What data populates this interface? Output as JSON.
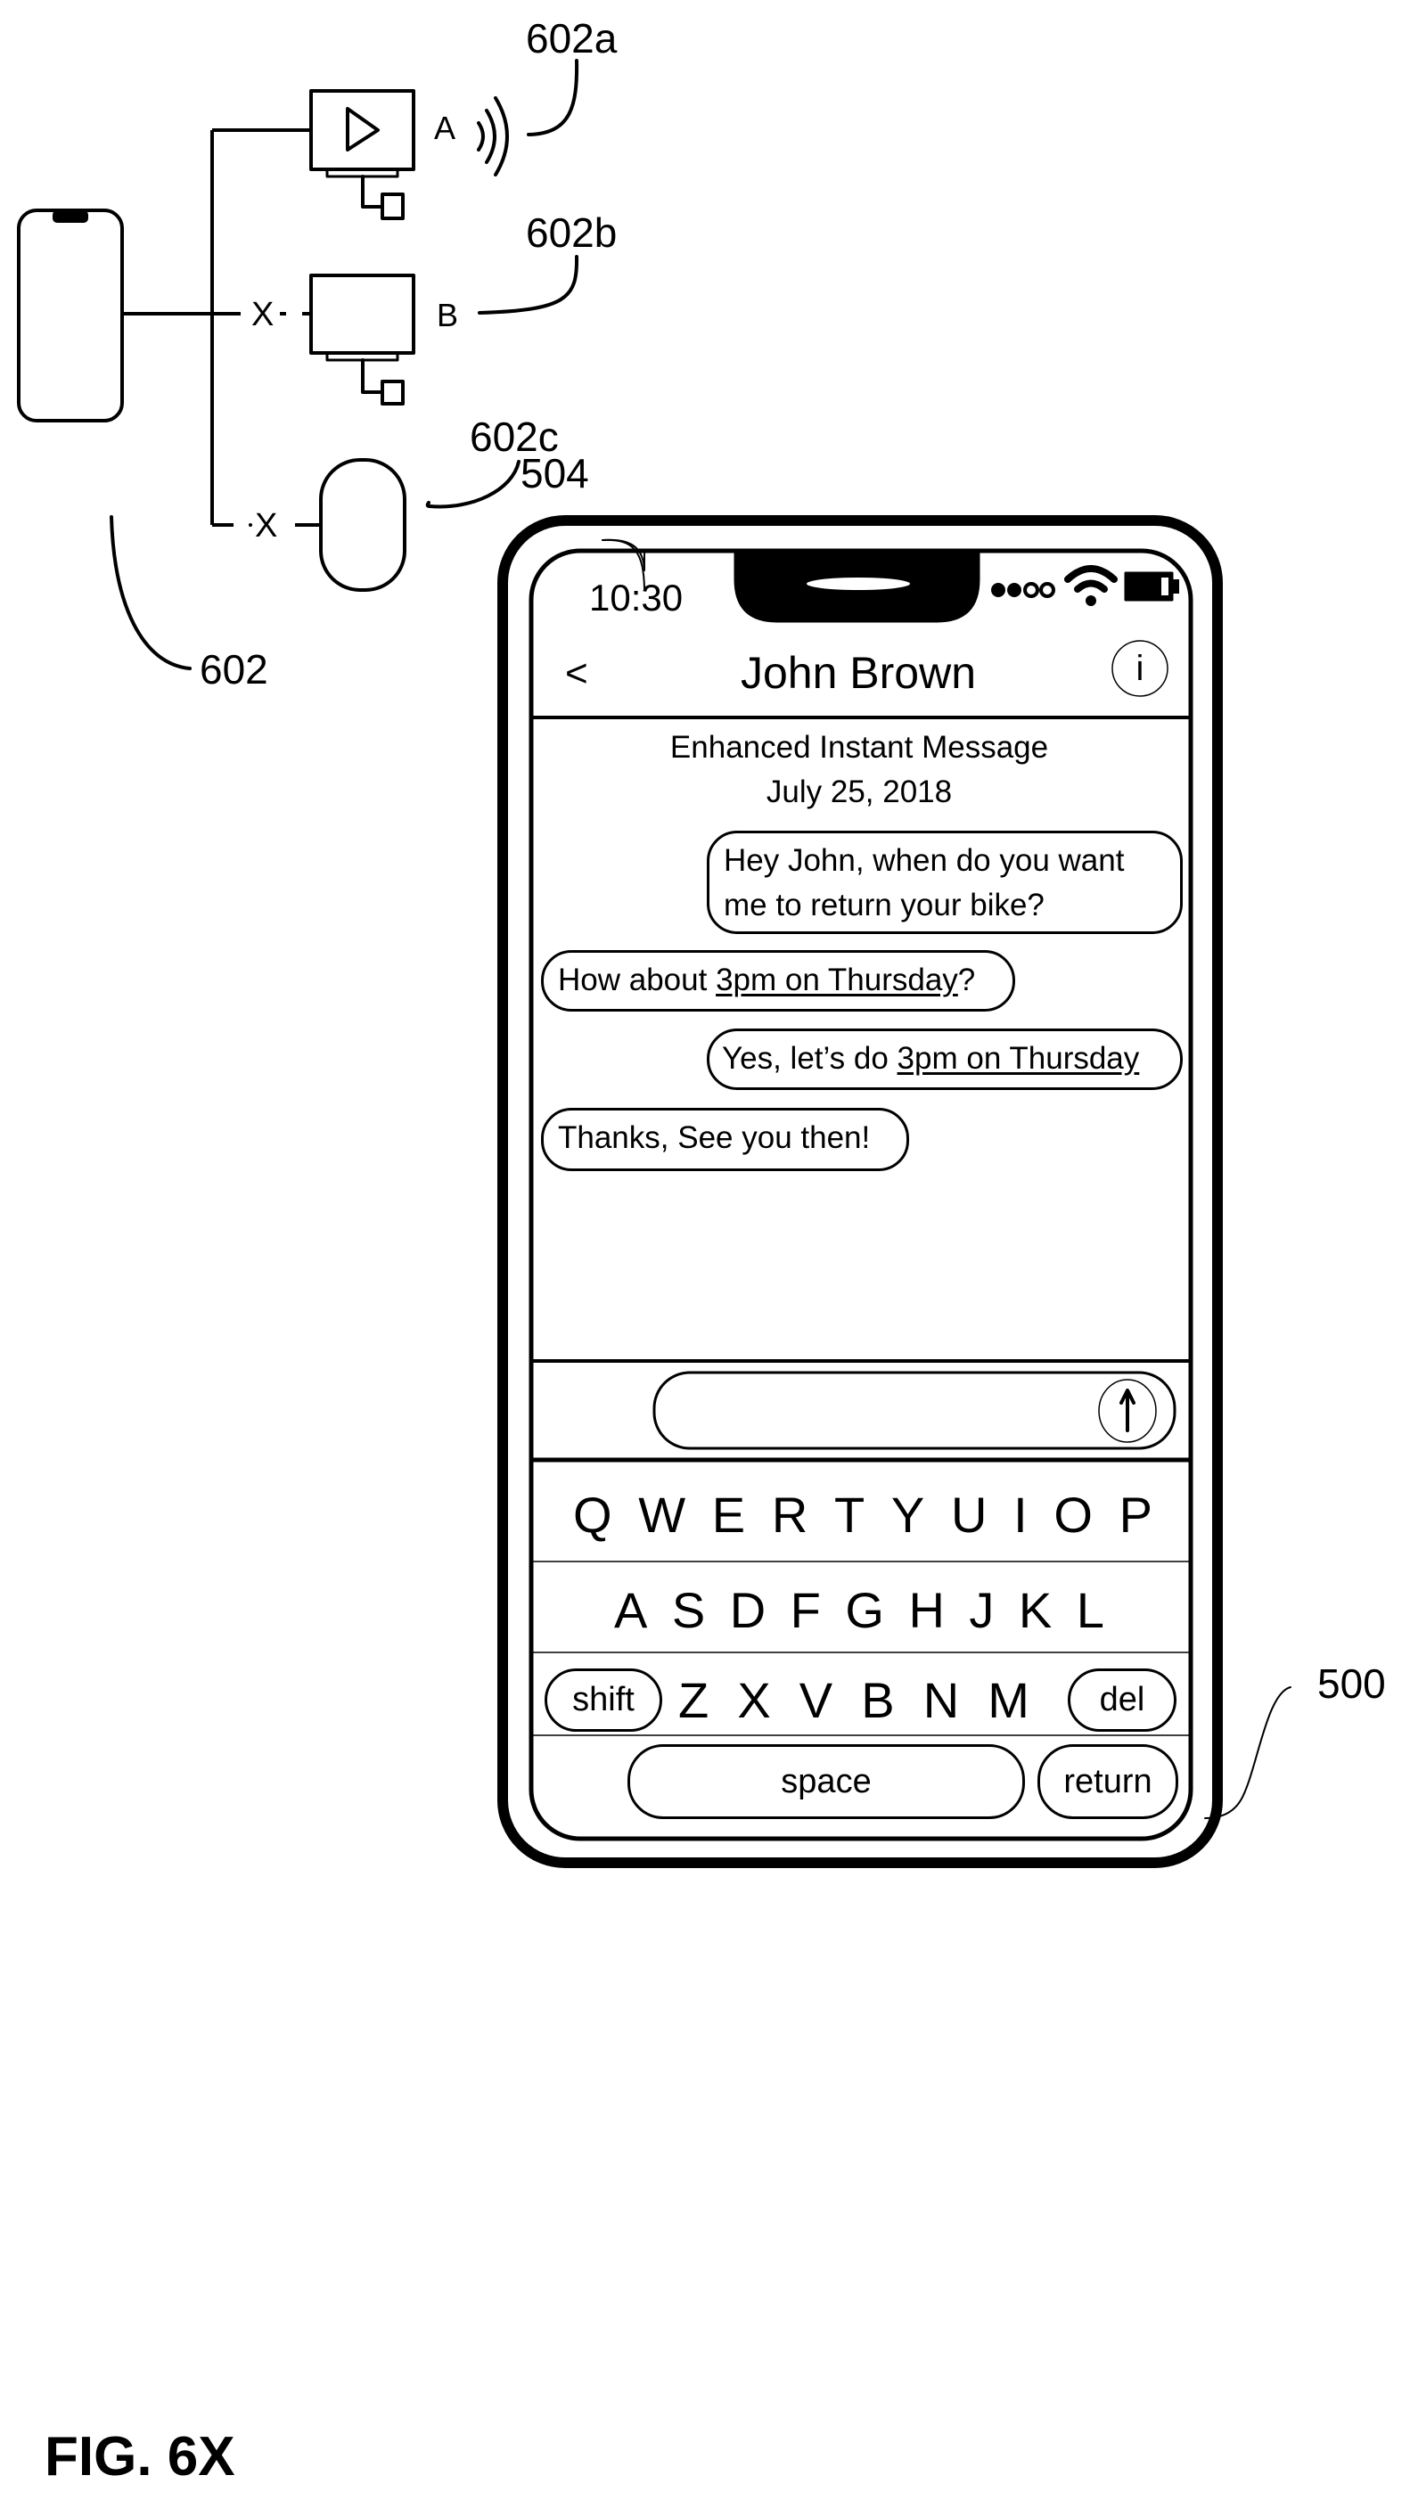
{
  "diagram": {
    "device_labels": {
      "a": "A",
      "b": "B"
    },
    "blocked_marks": {
      "b": "X",
      "c": "X"
    },
    "reference_labels": {
      "system": "602",
      "device_a": "602a",
      "device_b": "602b",
      "device_c": "602c",
      "screen": "504",
      "device": "500"
    },
    "figure_label": "FIG. 6X"
  },
  "phone": {
    "status_bar": {
      "time": "10:30",
      "icons": [
        "signal-dots-icon",
        "wifi-icon",
        "battery-icon"
      ]
    },
    "header": {
      "back": "<",
      "title": "John Brown",
      "info": "i"
    },
    "conversation": {
      "title": "Enhanced Instant Message",
      "date": "July 25, 2018",
      "messages": [
        {
          "side": "right",
          "before": "Hey John, when do you want me to return your bike?",
          "link": "",
          "after": ""
        },
        {
          "side": "left",
          "before": "How about ",
          "link": "3pm on Thursday",
          "after": "?"
        },
        {
          "side": "right",
          "before": "Yes, let’s do ",
          "link": "3pm on Thursday",
          "after": ""
        },
        {
          "side": "left",
          "before": "Thanks, See you then!",
          "link": "",
          "after": ""
        }
      ]
    },
    "compose": {
      "value": "",
      "send_icon": "arrow-up-icon"
    },
    "keyboard": {
      "row1": [
        "Q",
        "W",
        "E",
        "R",
        "T",
        "Y",
        "U",
        "I",
        "O",
        "P"
      ],
      "row2": [
        "A",
        "S",
        "D",
        "F",
        "G",
        "H",
        "J",
        "K",
        "L"
      ],
      "row3": [
        "Z",
        "X",
        "V",
        "B",
        "N",
        "M"
      ],
      "shift": "shift",
      "del": "del",
      "space": "space",
      "return": "return"
    }
  }
}
